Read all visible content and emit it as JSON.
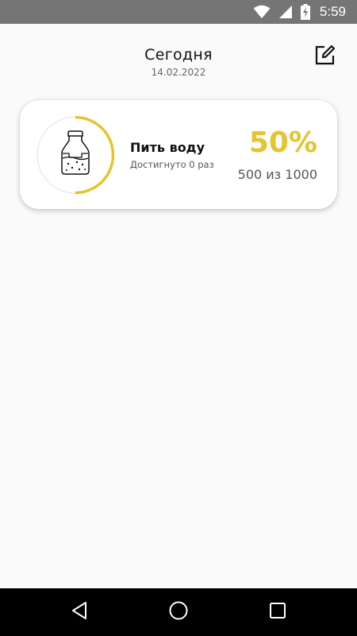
{
  "status_bar": {
    "time": "5:59",
    "icons": [
      "wifi-icon",
      "signal-icon",
      "battery-charging-icon"
    ]
  },
  "header": {
    "title": "Сегодня",
    "date": "14.02.2022",
    "edit_icon": "edit-icon"
  },
  "habits": [
    {
      "name": "Пить воду",
      "subtitle": "Достигнуто 0 раз",
      "percent_label": "50%",
      "progress": 0.5,
      "amount_label": "500 из 1000",
      "icon": "bottle-icon",
      "accent_color": "#e6c330"
    }
  ],
  "nav_bar": {
    "buttons": [
      "back-icon",
      "home-icon",
      "recents-icon"
    ]
  },
  "colors": {
    "status_bar": "#757575",
    "background": "#fafafa",
    "accent": "#e6c330",
    "nav_bar": "#000000"
  }
}
